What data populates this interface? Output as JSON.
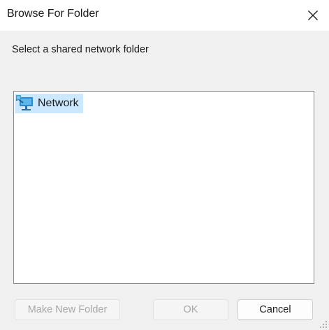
{
  "window": {
    "title": "Browse For Folder",
    "close_icon": "close-icon"
  },
  "prompt": "Select a shared network folder",
  "tree": {
    "items": [
      {
        "label": "Network",
        "icon": "network-icon",
        "selected": true
      }
    ]
  },
  "buttons": {
    "make_new_folder": "Make New Folder",
    "ok": "OK",
    "cancel": "Cancel"
  },
  "colors": {
    "selection": "#cce8ff",
    "dialog_background": "#f0f0f0",
    "disabled_text": "#a8a8a8"
  }
}
